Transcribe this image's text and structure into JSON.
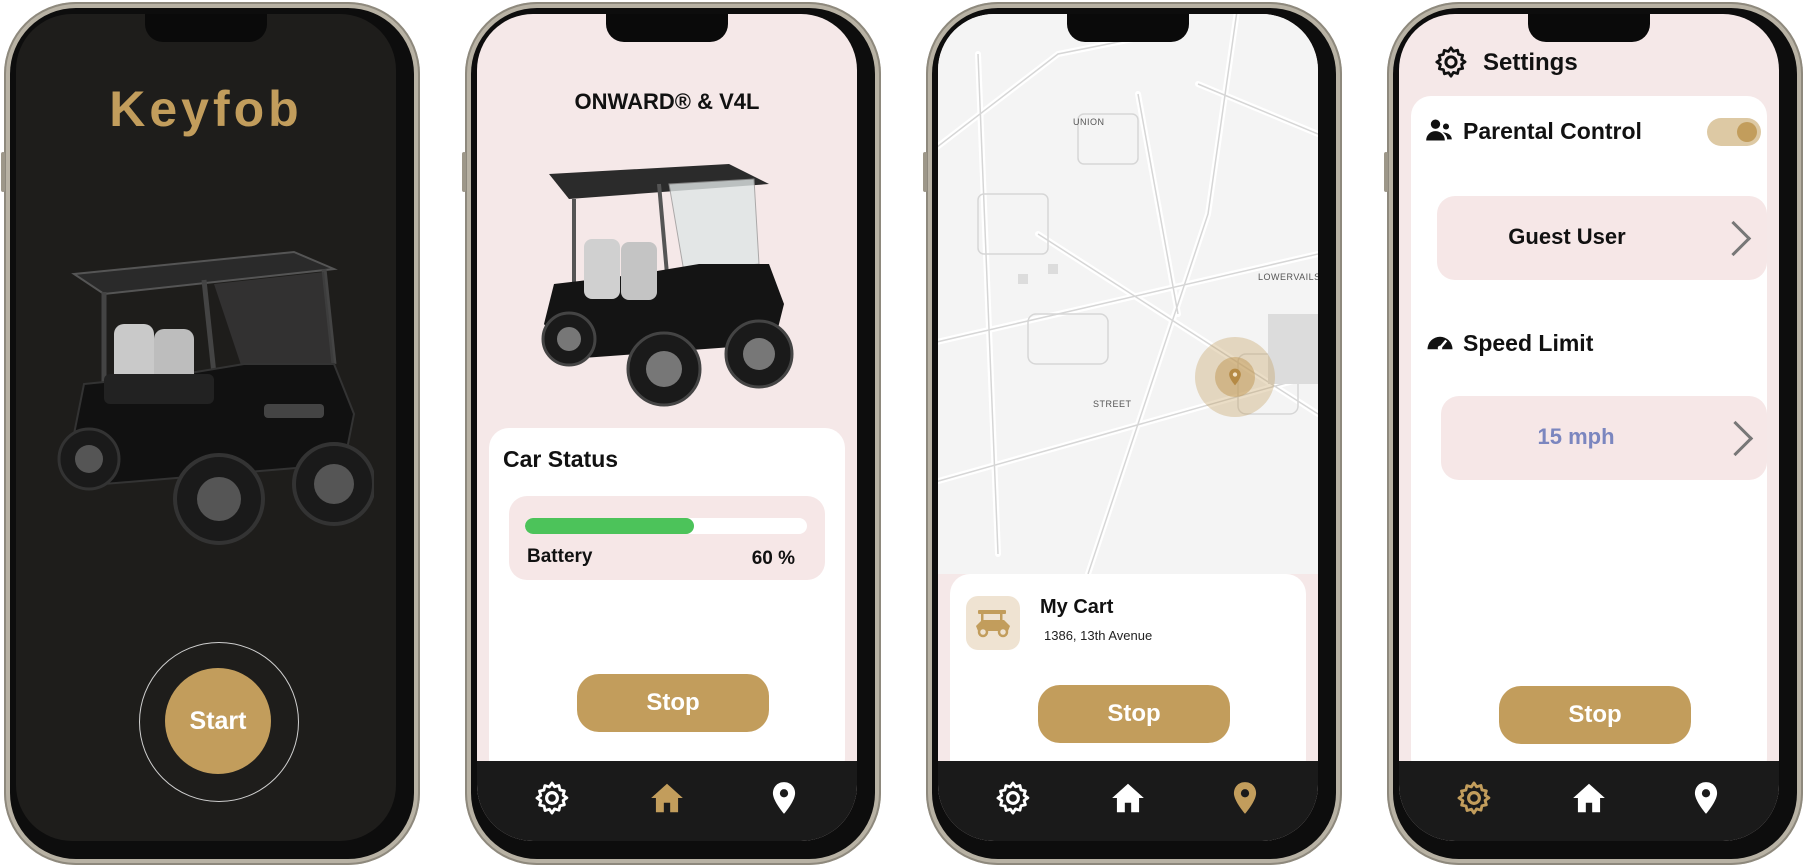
{
  "screen1": {
    "title": "Keyfob",
    "start_label": "Start",
    "image": "black-golf-cart-image"
  },
  "screen2": {
    "title": "ONWARD® & V4L",
    "image": "black-golf-cart-image",
    "status_title": "Car Status",
    "battery_label": "Battery",
    "battery_value": "60 %",
    "battery_fraction": 0.6,
    "stop_label": "Stop",
    "nav": [
      "gear-icon",
      "home-icon",
      "location-pin-icon"
    ],
    "active_nav": "home-icon"
  },
  "screen3": {
    "map_labels": [
      "UNION",
      "LOWERVAILSBURG",
      "STREET"
    ],
    "cart_name": "My Cart",
    "cart_address": "1386, 13th Avenue",
    "stop_label": "Stop",
    "nav": [
      "gear-icon",
      "home-icon",
      "location-pin-icon"
    ],
    "active_nav": "location-pin-icon"
  },
  "screen4": {
    "title": "Settings",
    "parental_label": "Parental Control",
    "parental_on": true,
    "guest_label": "Guest User",
    "speed_title": "Speed Limit",
    "speed_value": "15 mph",
    "stop_label": "Stop",
    "nav": [
      "gear-icon",
      "home-icon",
      "location-pin-icon"
    ],
    "active_nav": "gear-icon"
  },
  "colors": {
    "gold": "#c29d5c",
    "dark": "#1a1a1a",
    "pink": "#f5e8e8",
    "battery_green": "#4cc35a",
    "speed_text": "#7b86bf"
  }
}
